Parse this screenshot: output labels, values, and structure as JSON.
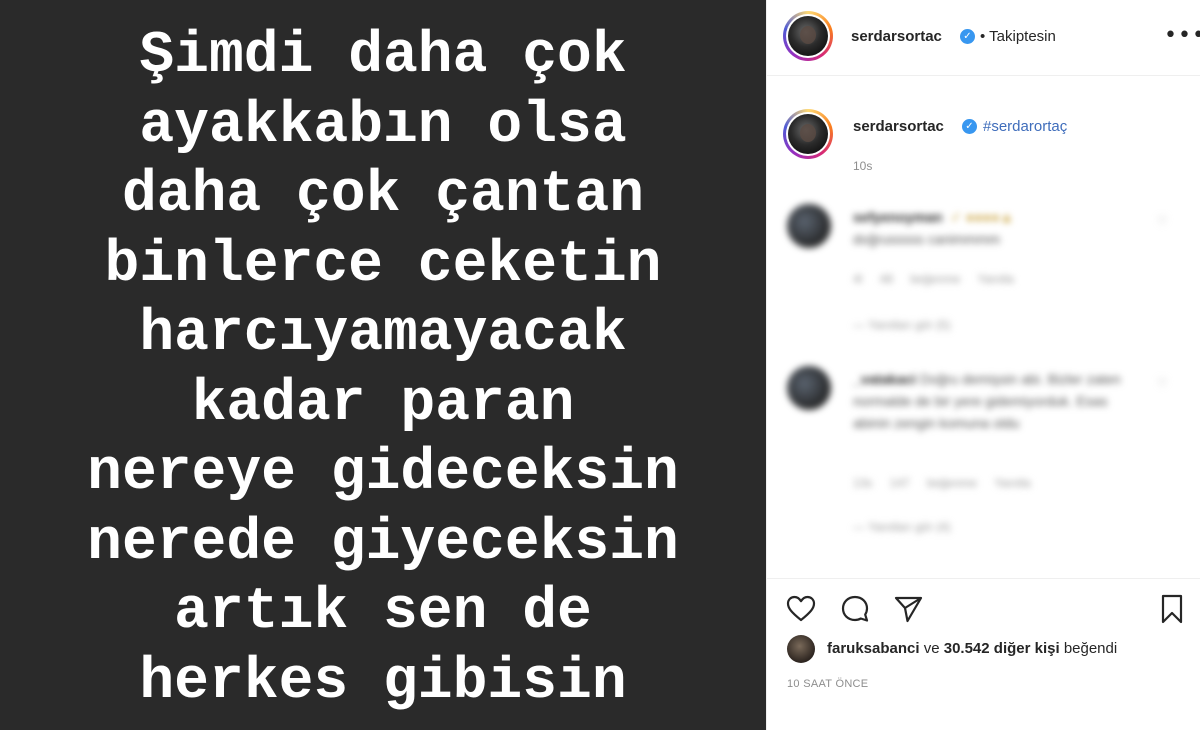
{
  "post": {
    "lines": [
      "Şimdi daha çok",
      "ayakkabın olsa",
      "daha çok çantan",
      "binlerce ceketin",
      "harcıyamayacak",
      "kadar paran",
      "nereye gideceksin",
      "nerede giyeceksin",
      "artık sen de",
      "herkes gibisin"
    ],
    "background_color": "#2a2a2a",
    "text_color": "#ffffff"
  },
  "header": {
    "username": "serdarsortac",
    "follow_status": "• Takiptesin",
    "more_icon": "more-horizontal-icon"
  },
  "caption": {
    "username": "serdarsortac",
    "hashtag": "#serdarortaç",
    "time": "10s"
  },
  "comments": [
    {
      "username": "sefyenoyman",
      "text": "doğrusssss canimmmm",
      "meta": "4l 48 beğenme Yanıtla",
      "replies": "— Yanıtları gör (5)"
    },
    {
      "username": "_vatakaci",
      "text": "Doğru demişsin abi. Bizler zaten normalde de bir yere gidemiyorduk. Esas abinin zengin komuna oldu",
      "meta": "13s 147 beğenme Yanıtla",
      "replies": "— Yanıtları gör (4)"
    }
  ],
  "actions": {
    "like_icon": "heart-icon",
    "comment_icon": "comment-icon",
    "share_icon": "send-icon",
    "save_icon": "bookmark-icon"
  },
  "likes": {
    "user": "faruksabanci",
    "connector": "ve",
    "count_text": "30.542 diğer kişi",
    "suffix": "beğendi"
  },
  "timestamp": "10 SAAT ÖNCE",
  "colors": {
    "verified": "#3897f0",
    "hashtag": "#3f6dbb",
    "muted": "#8e8e8e"
  }
}
